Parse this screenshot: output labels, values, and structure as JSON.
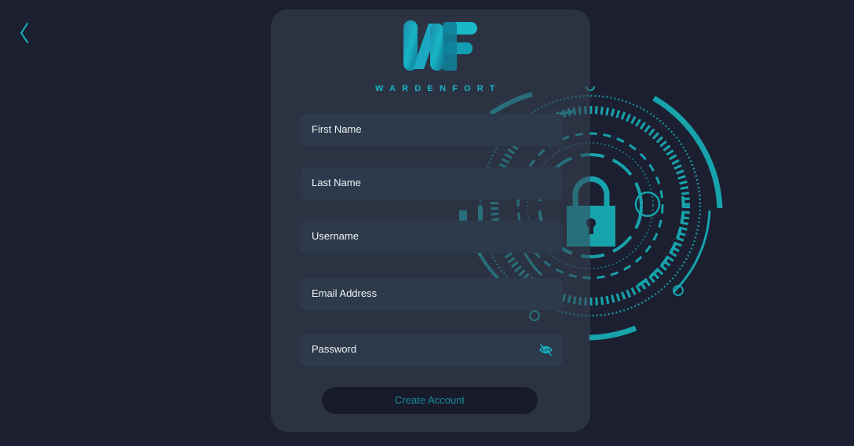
{
  "nav": {
    "back_icon": "chevron-left-icon"
  },
  "brand": {
    "wordmark": "WARDENFORT",
    "logo_letters": "WF"
  },
  "form": {
    "fields": [
      {
        "label": "First Name",
        "type": "text"
      },
      {
        "label": "Last Name",
        "type": "text"
      },
      {
        "label": "Username",
        "type": "text"
      },
      {
        "label": "Email Address",
        "type": "email"
      },
      {
        "label": "Password",
        "type": "password",
        "toggle_icon": "eye-off-icon"
      }
    ],
    "submit_label": "Create Account"
  },
  "illustration": {
    "icon": "padlock-shield-icon"
  },
  "colors": {
    "background": "#1b1f30",
    "card": "#384454",
    "field": "#2d3a4b",
    "accent": "#17b3c4",
    "accent_dark": "#0e8e98",
    "button": "#171b2b",
    "button_text": "#168d99"
  }
}
